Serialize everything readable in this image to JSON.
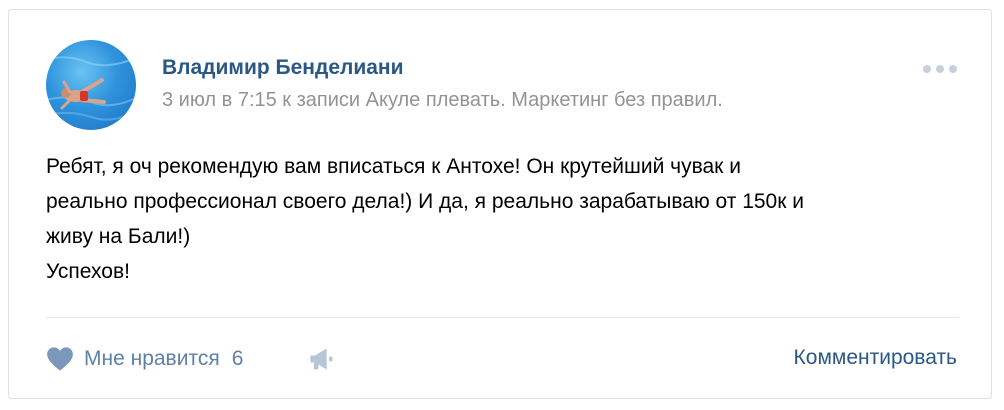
{
  "post": {
    "author": "Владимир Бенделиани",
    "meta": "3 июл в 7:15 к записи Акуле плевать. Маркетинг без правил.",
    "text_lines": [
      "Ребят, я оч рекомендую вам вписаться к Антохе! Он крутейший чувак и",
      "реально профессионал своего дела!) И да, я реально зарабатываю от 150к и",
      "живу на Бали!)",
      "Успехов!"
    ]
  },
  "actions": {
    "like_label": "Мне нравится",
    "like_count": "6",
    "comment_label": "Комментировать"
  },
  "icons": {
    "more": "more-dots-icon",
    "like": "heart-icon",
    "share": "megaphone-icon"
  },
  "colors": {
    "link": "#2a5885",
    "meta": "#939393",
    "action": "#5e81a8",
    "icon": "#7b97b9"
  }
}
